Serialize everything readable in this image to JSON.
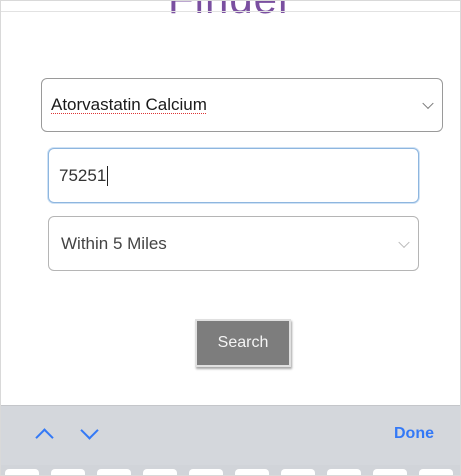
{
  "header": {
    "title": "Finder"
  },
  "form": {
    "drug_select": {
      "value": "Atorvastatin Calcium"
    },
    "zip_input": {
      "value": "75251"
    },
    "radius_select": {
      "value": "Within 5 Miles"
    },
    "search_label": "Search"
  },
  "keyboard_toolbar": {
    "up_icon": "chevron-up-icon",
    "down_icon": "chevron-down-icon",
    "done_label": "Done"
  },
  "colors": {
    "title": "#7a4fa0",
    "accent": "#3479f6",
    "button": "#7d7d7d"
  }
}
